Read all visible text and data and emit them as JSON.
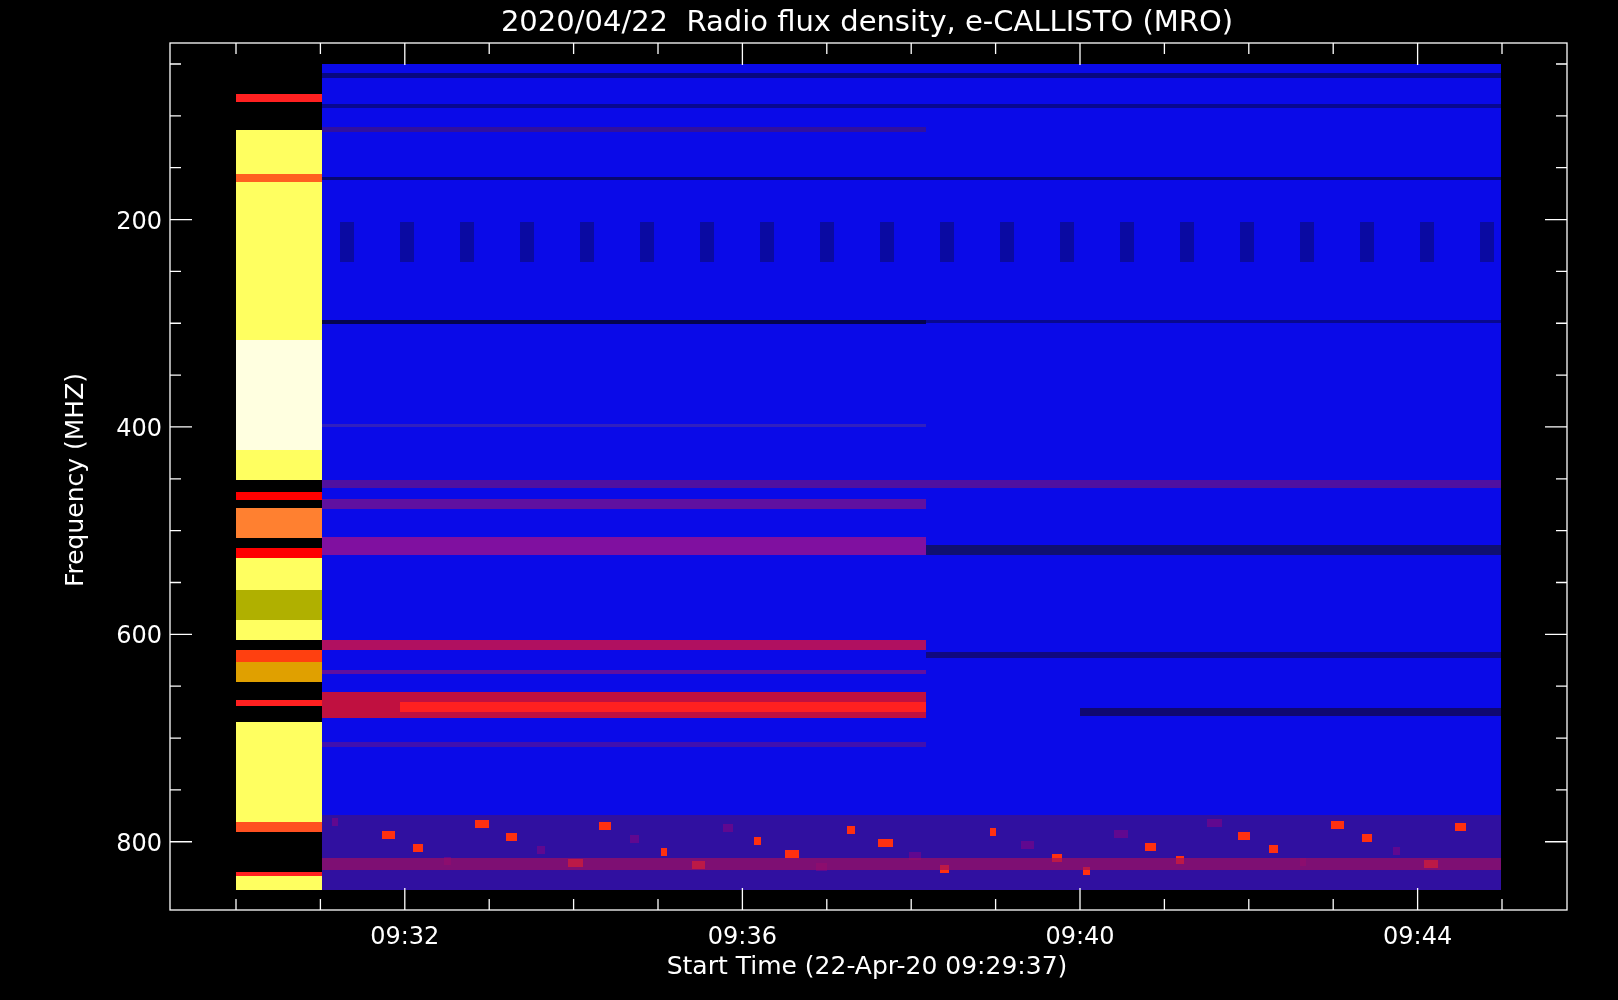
{
  "title": "2020/04/22  Radio flux density, e-CALLISTO (MRO)",
  "plot": {
    "ylabel": "Frequency (MHZ)",
    "yticks": [
      "200",
      "400",
      "600",
      "800"
    ],
    "xlabel": "Start Time (22-Apr-20 09:29:37)",
    "xticks": [
      "09:32",
      "09:36",
      "09:40",
      "09:44"
    ]
  }
}
